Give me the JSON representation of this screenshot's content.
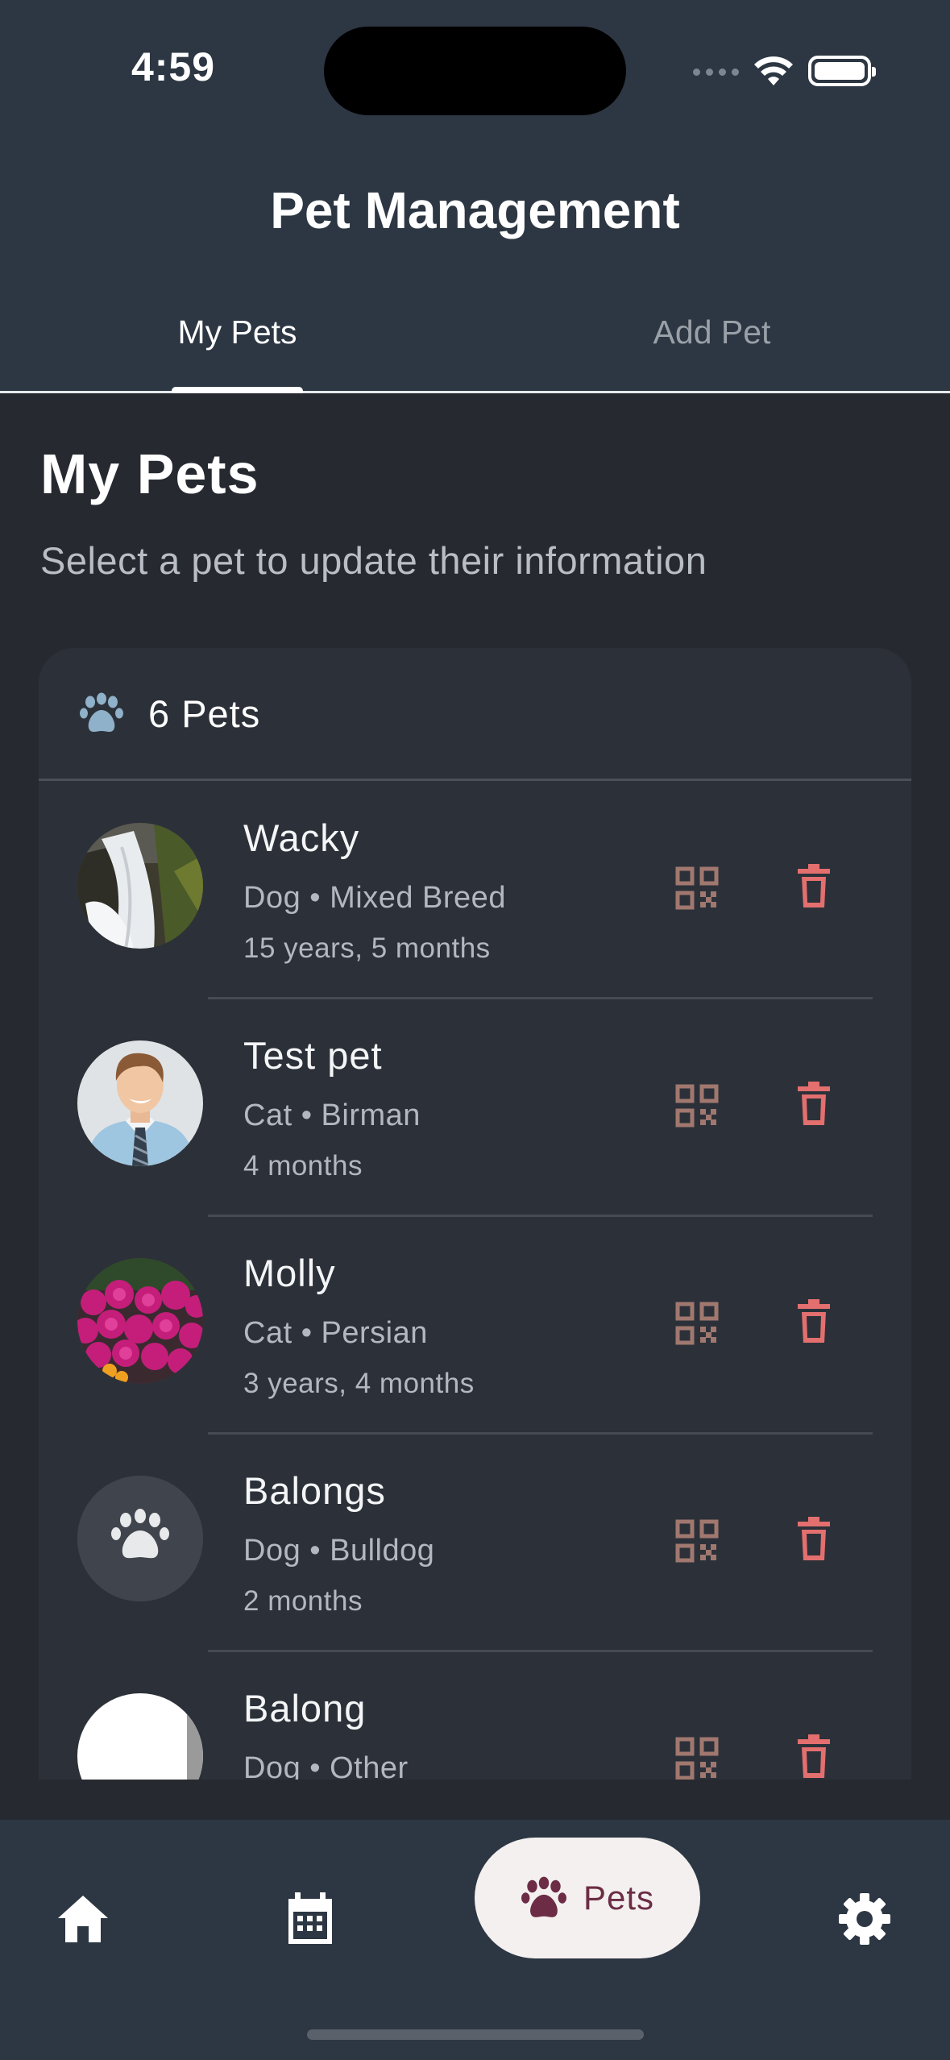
{
  "status_bar": {
    "time": "4:59"
  },
  "header": {
    "title": "Pet Management",
    "tabs": [
      {
        "label": "My Pets",
        "active": true
      },
      {
        "label": "Add Pet",
        "active": false
      }
    ]
  },
  "content": {
    "title": "My Pets",
    "subtitle": "Select a pet to update their information"
  },
  "pet_list": {
    "count_label": "6 Pets",
    "pets": [
      {
        "name": "Wacky",
        "type": "Dog • Mixed Breed",
        "age": "15 years, 5 months",
        "avatar": "waterfall-photo"
      },
      {
        "name": "Test pet",
        "type": "Cat • Birman",
        "age": "4 months",
        "avatar": "man-portrait-photo"
      },
      {
        "name": "Molly",
        "type": "Cat • Persian",
        "age": "3 years, 4 months",
        "avatar": "flowers-photo"
      },
      {
        "name": "Balongs",
        "type": "Dog • Bulldog",
        "age": "2 months",
        "avatar": "paw-placeholder"
      },
      {
        "name": "Balong",
        "type": "Dog • Other",
        "age": "",
        "avatar": "white-photo"
      }
    ]
  },
  "bottom_nav": {
    "items": [
      {
        "icon": "home-icon",
        "label": ""
      },
      {
        "icon": "calendar-icon",
        "label": ""
      },
      {
        "icon": "paw-icon",
        "label": "Pets",
        "active": true
      },
      {
        "icon": "gear-icon",
        "label": ""
      }
    ]
  },
  "colors": {
    "header_bg": "#2d3743",
    "page_bg": "#262a30",
    "card_bg": "#2c3139",
    "qr_color": "#a1786f",
    "delete_color": "#e36f6f",
    "paw_accent": "#8fb1c9",
    "active_nav_bg": "#f3f0ef",
    "active_nav_fg": "#6c2c45"
  }
}
